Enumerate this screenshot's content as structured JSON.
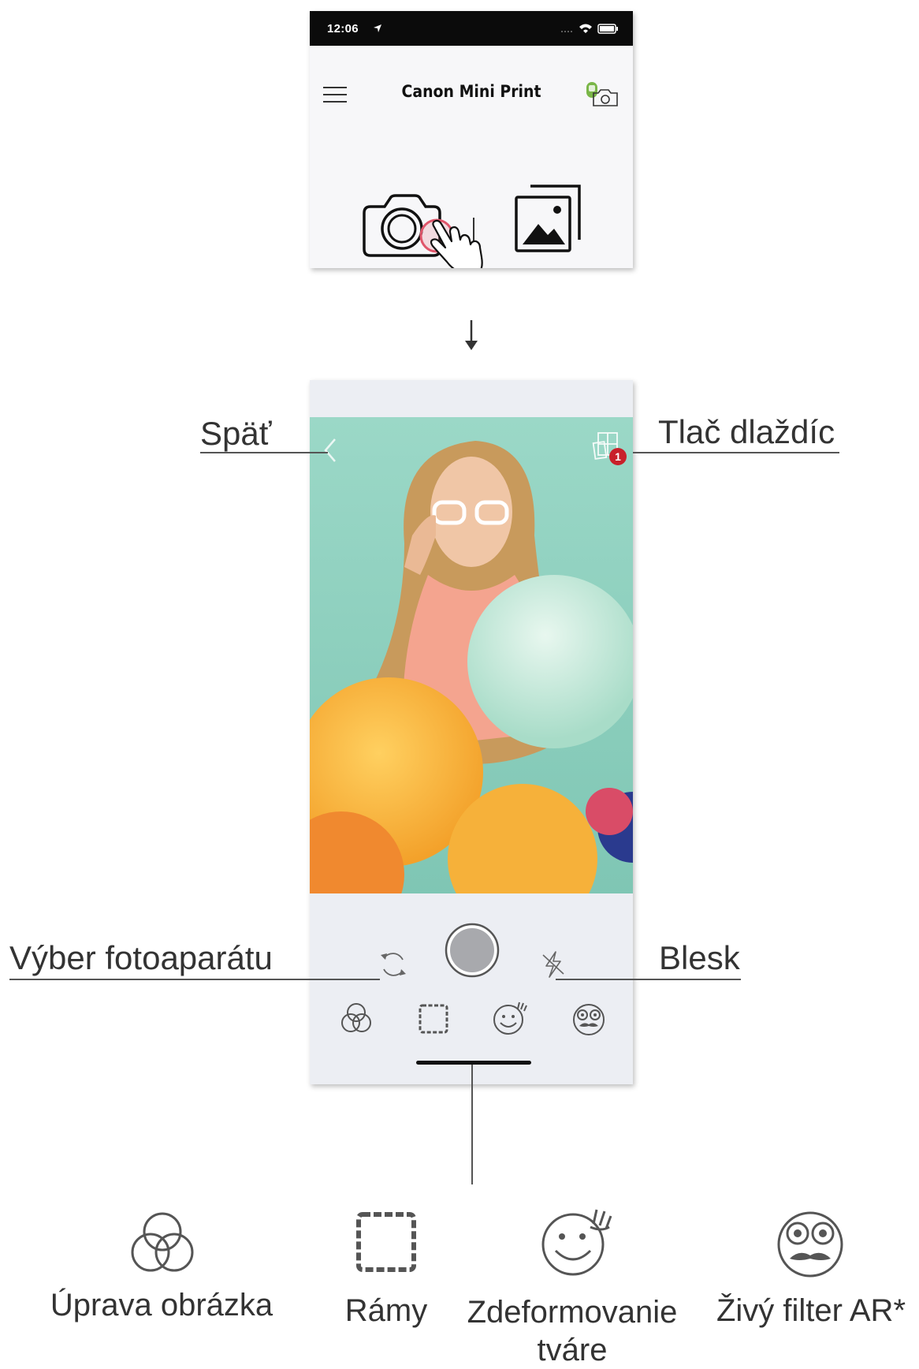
{
  "top_phone": {
    "status_time": "12:06",
    "app_title": "Canon Mini Print",
    "icons": [
      "menu-icon",
      "printer-connected-icon",
      "camera-icon",
      "gallery-icon",
      "tap-hand-icon"
    ]
  },
  "callouts": {
    "back": "Späť",
    "tile_print": "Tlač dlaždíc",
    "tile_badge": "1",
    "camera_select": "Výber fotoaparátu",
    "flash": "Blesk"
  },
  "toolbar": {
    "items": [
      {
        "icon": "image-adjust-icon",
        "label": "Úprava obrázka"
      },
      {
        "icon": "frames-icon",
        "label": "Rámy"
      },
      {
        "icon": "face-warp-icon",
        "label": "Zdeformovanie tváre"
      },
      {
        "icon": "live-ar-filter-icon",
        "label": "Živý filter AR*"
      }
    ]
  },
  "colors": {
    "status_bar": "#0b0b0b",
    "app_background": "#f7f7f9",
    "camera_background": "#eceef3",
    "touch_highlight": "#e0566b",
    "badge_red": "#c8202a",
    "printer_green": "#7ab648",
    "shutter_gray": "#a8a9ad"
  }
}
